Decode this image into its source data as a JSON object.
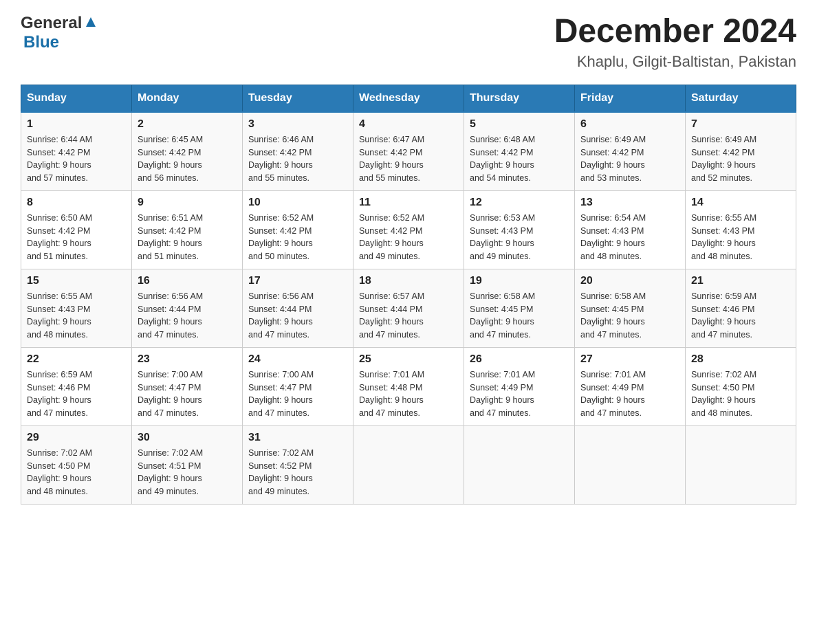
{
  "header": {
    "logo_general": "General",
    "logo_blue": "Blue",
    "month": "December 2024",
    "location": "Khaplu, Gilgit-Baltistan, Pakistan"
  },
  "days_of_week": [
    "Sunday",
    "Monday",
    "Tuesday",
    "Wednesday",
    "Thursday",
    "Friday",
    "Saturday"
  ],
  "weeks": [
    [
      {
        "day": "1",
        "sunrise": "6:44 AM",
        "sunset": "4:42 PM",
        "daylight": "9 hours and 57 minutes."
      },
      {
        "day": "2",
        "sunrise": "6:45 AM",
        "sunset": "4:42 PM",
        "daylight": "9 hours and 56 minutes."
      },
      {
        "day": "3",
        "sunrise": "6:46 AM",
        "sunset": "4:42 PM",
        "daylight": "9 hours and 55 minutes."
      },
      {
        "day": "4",
        "sunrise": "6:47 AM",
        "sunset": "4:42 PM",
        "daylight": "9 hours and 55 minutes."
      },
      {
        "day": "5",
        "sunrise": "6:48 AM",
        "sunset": "4:42 PM",
        "daylight": "9 hours and 54 minutes."
      },
      {
        "day": "6",
        "sunrise": "6:49 AM",
        "sunset": "4:42 PM",
        "daylight": "9 hours and 53 minutes."
      },
      {
        "day": "7",
        "sunrise": "6:49 AM",
        "sunset": "4:42 PM",
        "daylight": "9 hours and 52 minutes."
      }
    ],
    [
      {
        "day": "8",
        "sunrise": "6:50 AM",
        "sunset": "4:42 PM",
        "daylight": "9 hours and 51 minutes."
      },
      {
        "day": "9",
        "sunrise": "6:51 AM",
        "sunset": "4:42 PM",
        "daylight": "9 hours and 51 minutes."
      },
      {
        "day": "10",
        "sunrise": "6:52 AM",
        "sunset": "4:42 PM",
        "daylight": "9 hours and 50 minutes."
      },
      {
        "day": "11",
        "sunrise": "6:52 AM",
        "sunset": "4:42 PM",
        "daylight": "9 hours and 49 minutes."
      },
      {
        "day": "12",
        "sunrise": "6:53 AM",
        "sunset": "4:43 PM",
        "daylight": "9 hours and 49 minutes."
      },
      {
        "day": "13",
        "sunrise": "6:54 AM",
        "sunset": "4:43 PM",
        "daylight": "9 hours and 48 minutes."
      },
      {
        "day": "14",
        "sunrise": "6:55 AM",
        "sunset": "4:43 PM",
        "daylight": "9 hours and 48 minutes."
      }
    ],
    [
      {
        "day": "15",
        "sunrise": "6:55 AM",
        "sunset": "4:43 PM",
        "daylight": "9 hours and 48 minutes."
      },
      {
        "day": "16",
        "sunrise": "6:56 AM",
        "sunset": "4:44 PM",
        "daylight": "9 hours and 47 minutes."
      },
      {
        "day": "17",
        "sunrise": "6:56 AM",
        "sunset": "4:44 PM",
        "daylight": "9 hours and 47 minutes."
      },
      {
        "day": "18",
        "sunrise": "6:57 AM",
        "sunset": "4:44 PM",
        "daylight": "9 hours and 47 minutes."
      },
      {
        "day": "19",
        "sunrise": "6:58 AM",
        "sunset": "4:45 PM",
        "daylight": "9 hours and 47 minutes."
      },
      {
        "day": "20",
        "sunrise": "6:58 AM",
        "sunset": "4:45 PM",
        "daylight": "9 hours and 47 minutes."
      },
      {
        "day": "21",
        "sunrise": "6:59 AM",
        "sunset": "4:46 PM",
        "daylight": "9 hours and 47 minutes."
      }
    ],
    [
      {
        "day": "22",
        "sunrise": "6:59 AM",
        "sunset": "4:46 PM",
        "daylight": "9 hours and 47 minutes."
      },
      {
        "day": "23",
        "sunrise": "7:00 AM",
        "sunset": "4:47 PM",
        "daylight": "9 hours and 47 minutes."
      },
      {
        "day": "24",
        "sunrise": "7:00 AM",
        "sunset": "4:47 PM",
        "daylight": "9 hours and 47 minutes."
      },
      {
        "day": "25",
        "sunrise": "7:01 AM",
        "sunset": "4:48 PM",
        "daylight": "9 hours and 47 minutes."
      },
      {
        "day": "26",
        "sunrise": "7:01 AM",
        "sunset": "4:49 PM",
        "daylight": "9 hours and 47 minutes."
      },
      {
        "day": "27",
        "sunrise": "7:01 AM",
        "sunset": "4:49 PM",
        "daylight": "9 hours and 47 minutes."
      },
      {
        "day": "28",
        "sunrise": "7:02 AM",
        "sunset": "4:50 PM",
        "daylight": "9 hours and 48 minutes."
      }
    ],
    [
      {
        "day": "29",
        "sunrise": "7:02 AM",
        "sunset": "4:50 PM",
        "daylight": "9 hours and 48 minutes."
      },
      {
        "day": "30",
        "sunrise": "7:02 AM",
        "sunset": "4:51 PM",
        "daylight": "9 hours and 49 minutes."
      },
      {
        "day": "31",
        "sunrise": "7:02 AM",
        "sunset": "4:52 PM",
        "daylight": "9 hours and 49 minutes."
      },
      null,
      null,
      null,
      null
    ]
  ],
  "labels": {
    "sunrise": "Sunrise:",
    "sunset": "Sunset:",
    "daylight": "Daylight:"
  }
}
